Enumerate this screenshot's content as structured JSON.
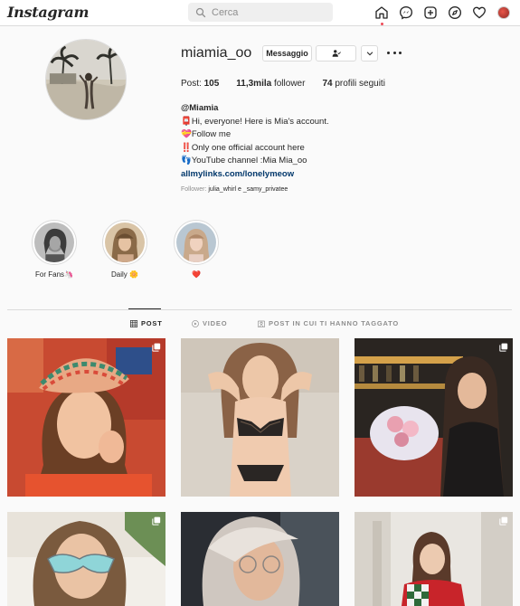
{
  "nav": {
    "logo": "Instagram",
    "search_placeholder": "Cerca",
    "icons": [
      "home-icon",
      "messenger-icon",
      "new-post-icon",
      "explore-icon",
      "activity-heart-icon",
      "profile-avatar"
    ]
  },
  "profile": {
    "username": "miamia_oo",
    "message_button": "Messaggio",
    "stats": {
      "posts_label": "Post:",
      "posts_value": "105",
      "followers_value": "11,3mila",
      "followers_label": "follower",
      "following_value": "74",
      "following_label": "profili seguiti"
    },
    "bio": {
      "full_name": "@Miamia",
      "lines": [
        "📮Hi, everyone! Here is Mia's account.",
        "💝Follow me",
        "‼️Only one official account here",
        "👣YouTube channel :Mia Mia_oo"
      ],
      "link": "allmylinks.com/lonelymeow"
    },
    "followed_by": {
      "prefix": "Follower:",
      "names": "julia_whirl e _samy_privatee"
    }
  },
  "highlights": [
    {
      "label": "For Fans🦄"
    },
    {
      "label": "Daily 🌼"
    },
    {
      "label": "❤️"
    }
  ],
  "tabs": [
    {
      "label": "POST",
      "active": true
    },
    {
      "label": "VIDEO",
      "active": false
    },
    {
      "label": "POST IN CUI TI HANNO TAGGATO",
      "active": false
    }
  ],
  "colors": {
    "link": "#00376b",
    "secondary_text": "#8e8e8e",
    "border": "#dbdbdb",
    "notification_dot": "#ed4956"
  }
}
